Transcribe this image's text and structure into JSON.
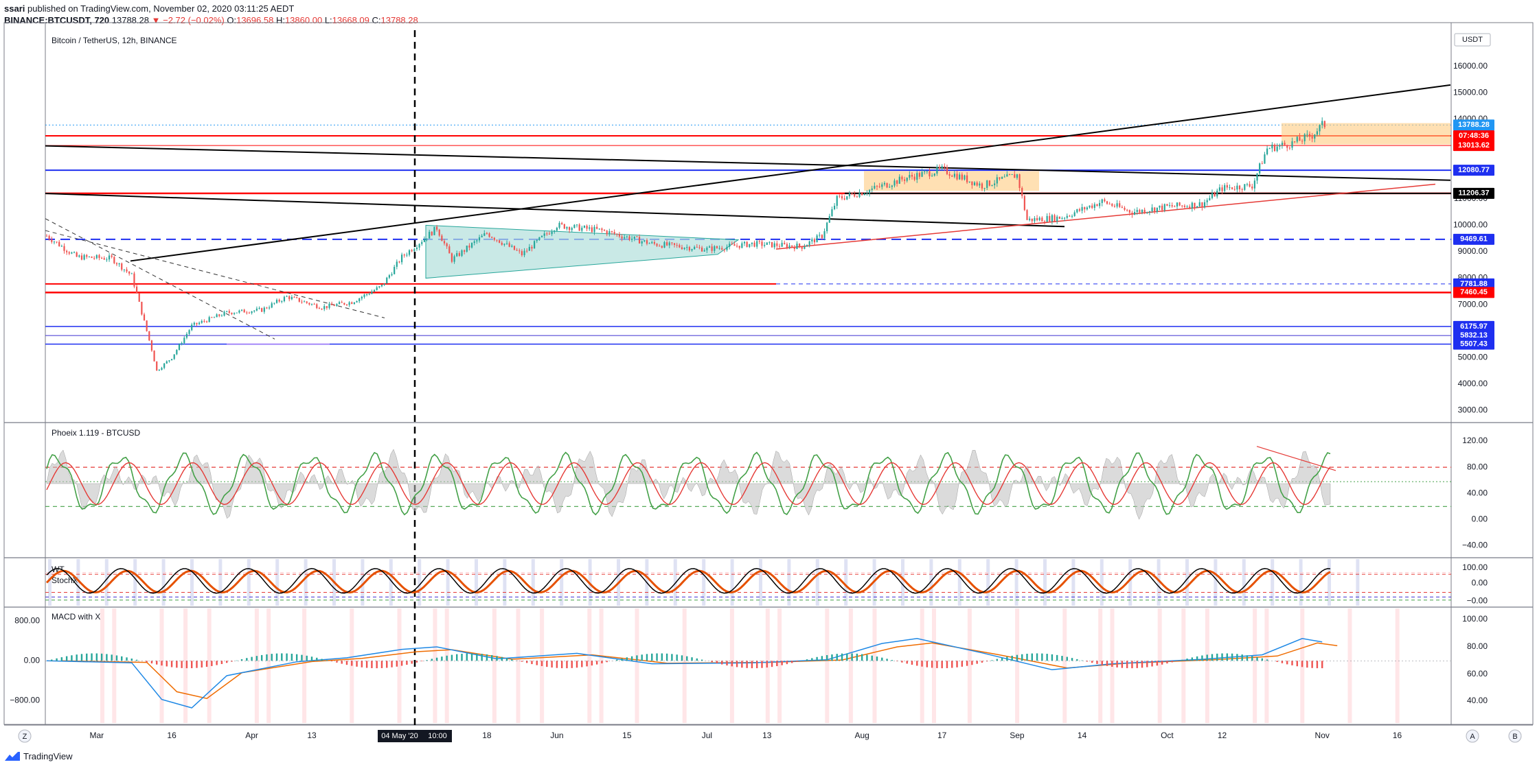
{
  "header": {
    "publisher": "ssari",
    "published_text": "published on TradingView.com, November 02, 2020 03:11:25 AEDT",
    "symbol_line": "BINANCE:BTCUSDT, 720",
    "last": "13788.28",
    "change": "▼ −2.72 (−0.02%)",
    "o_label": "O:",
    "o": "13696.58",
    "h_label": "H:",
    "h": "13860.00",
    "l_label": "L:",
    "l": "13668.09",
    "c_label": "C:",
    "c": "13788.28"
  },
  "footer": {
    "brand": "TradingView"
  },
  "colors": {
    "up": "#26a69a",
    "down": "#ef5350",
    "blue": "#1e2ff0",
    "red": "#ff0000",
    "black": "#000000"
  },
  "chart_data": [
    {
      "type": "candlestick",
      "title": "Bitcoin / TetherUS, 12h, BINANCE",
      "scale_label": "USDT",
      "y_ticks": [
        3000,
        4000,
        5000,
        6000,
        7000,
        8000,
        9000,
        10000,
        11000,
        12000,
        13000,
        14000,
        15000,
        16000
      ],
      "ylim": [
        2700,
        17500
      ],
      "x_ticks": [
        "Mar",
        "16",
        "Apr",
        "13",
        "May",
        "18",
        "Jun",
        "15",
        "Jul",
        "13",
        "Aug",
        "17",
        "Sep",
        "14",
        "Oct",
        "12",
        "Nov",
        "16"
      ],
      "crosshair_label": "04 May '20",
      "crosshair_time": "10:00",
      "price_tags": [
        {
          "value": 13788.28,
          "text": "13788.28",
          "color": "#2196f3"
        },
        {
          "value": 13380,
          "text": "07:48:36",
          "color": "#ff0000"
        },
        {
          "value": 13013.62,
          "text": "13013.62",
          "color": "#ff0000"
        },
        {
          "value": 12080.77,
          "text": "12080.77",
          "color": "#1e2ff0"
        },
        {
          "value": 11206.37,
          "text": "11206.37",
          "color": "#000000"
        },
        {
          "value": 9469.61,
          "text": "9469.61",
          "color": "#1e2ff0"
        },
        {
          "value": 7781.88,
          "text": "7781.88",
          "color": "#1e2ff0"
        },
        {
          "value": 7460.45,
          "text": "7460.45",
          "color": "#ff0000"
        },
        {
          "value": 6175.97,
          "text": "6175.97",
          "color": "#1e2ff0"
        },
        {
          "value": 5832.13,
          "text": "5832.13",
          "color": "#1e2ff0"
        },
        {
          "value": 5507.43,
          "text": "5507.43",
          "color": "#1e2ff0"
        }
      ],
      "price_path": [
        [
          "Feb 20",
          9600
        ],
        [
          "Feb 26",
          8800
        ],
        [
          "Mar 4",
          8750
        ],
        [
          "Mar 8",
          8100
        ],
        [
          "Mar 12",
          5300
        ],
        [
          "Mar 13",
          4500
        ],
        [
          "Mar 16",
          5000
        ],
        [
          "Mar 20",
          6200
        ],
        [
          "Mar 27",
          6700
        ],
        [
          "Apr 3",
          6800
        ],
        [
          "Apr 8",
          7300
        ],
        [
          "Apr 15",
          6900
        ],
        [
          "Apr 21",
          7100
        ],
        [
          "Apr 27",
          7700
        ],
        [
          "May 1",
          8800
        ],
        [
          "May 8",
          9900
        ],
        [
          "May 11",
          8700
        ],
        [
          "May 18",
          9700
        ],
        [
          "May 25",
          8900
        ],
        [
          "Jun 1",
          10000
        ],
        [
          "Jun 10",
          9800
        ],
        [
          "Jun 20",
          9300
        ],
        [
          "Jul 1",
          9100
        ],
        [
          "Jul 10",
          9300
        ],
        [
          "Jul 20",
          9200
        ],
        [
          "Jul 24",
          9600
        ],
        [
          "Jul 27",
          11000
        ],
        [
          "Aug 2",
          11300
        ],
        [
          "Aug 10",
          11800
        ],
        [
          "Aug 17",
          12100
        ],
        [
          "Aug 25",
          11500
        ],
        [
          "Sep 1",
          11900
        ],
        [
          "Sep 3",
          10200
        ],
        [
          "Sep 10",
          10300
        ],
        [
          "Sep 18",
          10900
        ],
        [
          "Sep 24",
          10500
        ],
        [
          "Oct 1",
          10700
        ],
        [
          "Oct 8",
          10800
        ],
        [
          "Oct 12",
          11400
        ],
        [
          "Oct 18",
          11500
        ],
        [
          "Oct 21",
          12900
        ],
        [
          "Oct 26",
          13100
        ],
        [
          "Oct 30",
          13400
        ],
        [
          "Nov 1",
          13788
        ]
      ]
    },
    {
      "type": "line",
      "title": "Phoeix 1.119 - BTCUSD",
      "y_ticks": [
        -40.0,
        0.0,
        40.0,
        80.0,
        120.0
      ],
      "y_tick_labels": [
        "−40.00",
        "0.00",
        "40.00",
        "80.00",
        "120.00"
      ],
      "ylim": [
        -50,
        140
      ],
      "levels": [
        80,
        58,
        20
      ],
      "series": [
        {
          "color": "#43a047"
        },
        {
          "color": "#e53935"
        },
        {
          "color": "#000000"
        }
      ]
    },
    {
      "type": "line",
      "labels": [
        "WT",
        "StochX"
      ],
      "y_tick_labels": [
        "100.00",
        "0.00",
        "−0.00"
      ],
      "ylim": [
        -120,
        130
      ]
    },
    {
      "type": "histogram",
      "title": "MACD with X",
      "left_ticks": [
        "800.00",
        "0.00",
        "−800.00"
      ],
      "right_ticks": [
        "100.00",
        "80.00",
        "60.00",
        "40.00"
      ],
      "ylim": [
        -1200,
        1000
      ]
    }
  ]
}
